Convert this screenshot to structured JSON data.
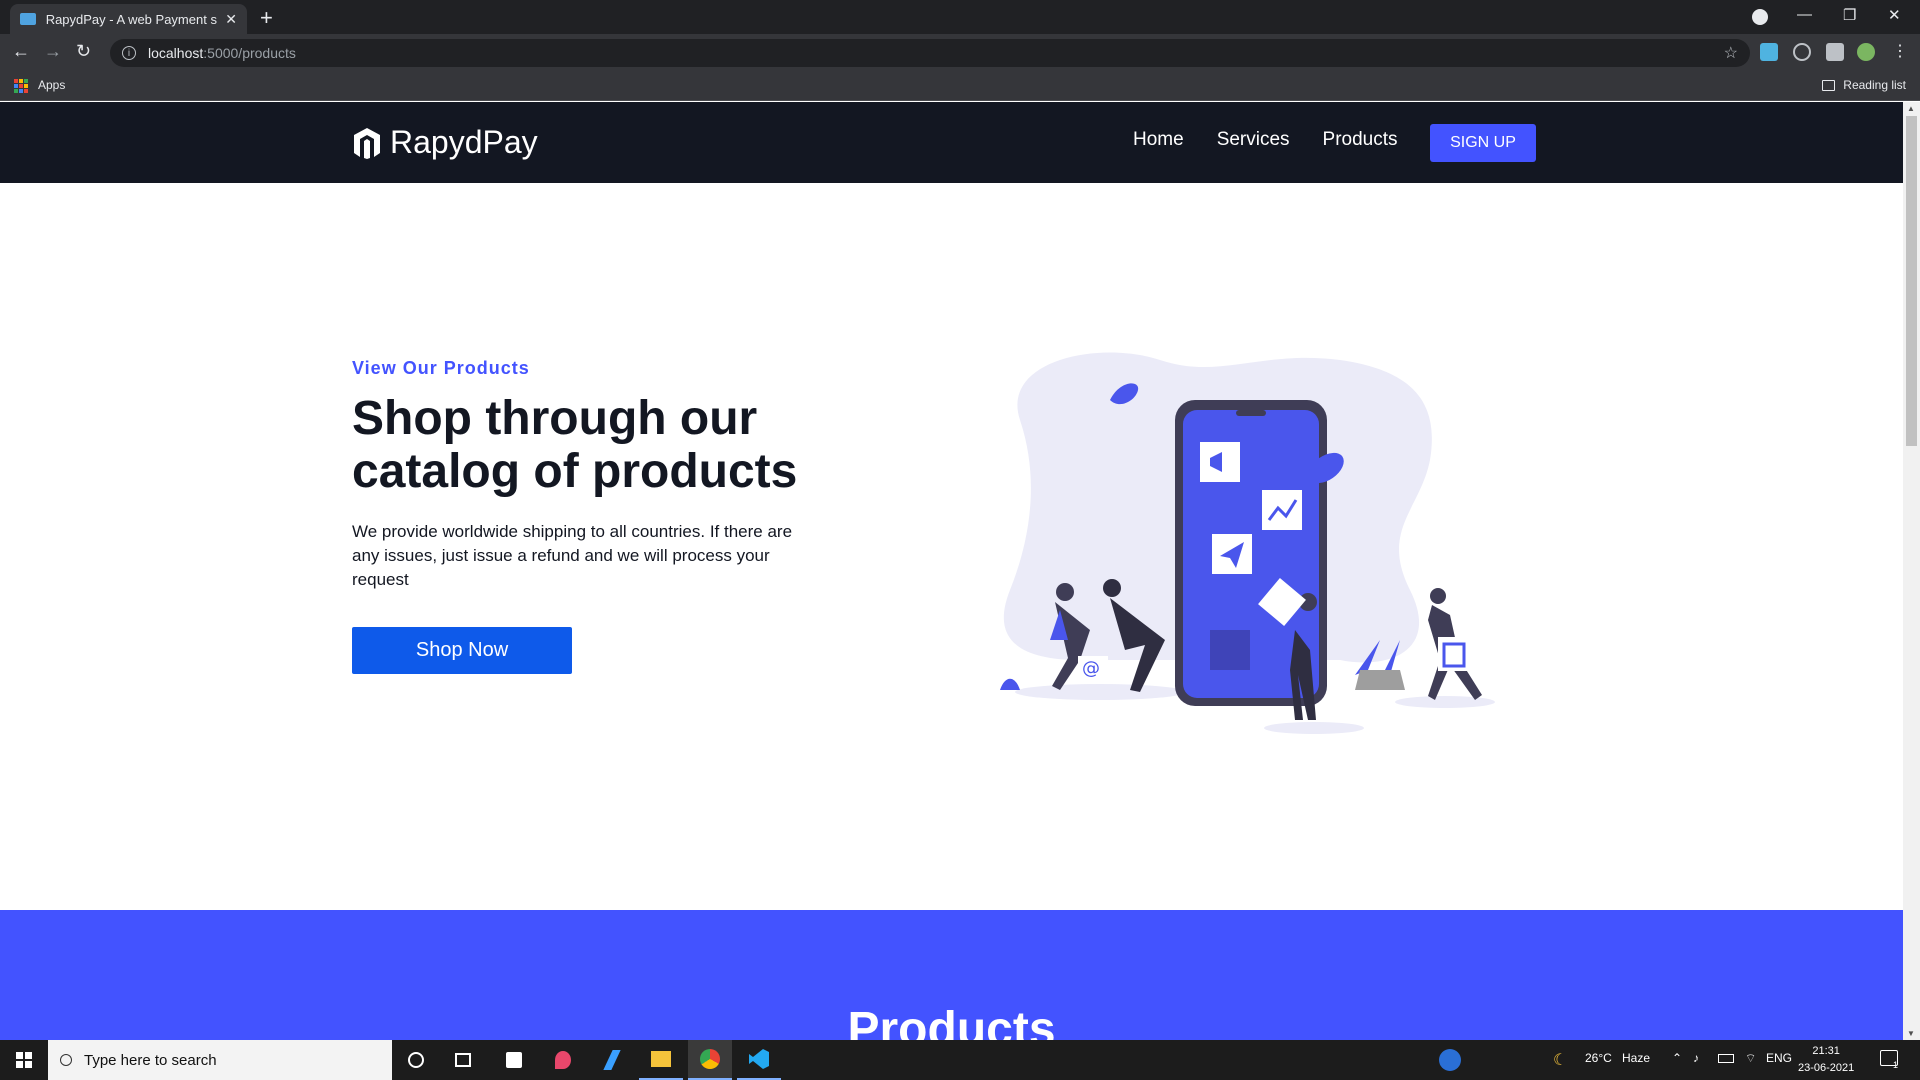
{
  "browser": {
    "tab_title": "RapydPay - A web Payment syste",
    "url_host": "localhost",
    "url_path": ":5000/products",
    "bookmark_apps": "Apps",
    "reading_list": "Reading list"
  },
  "navbar": {
    "brand": "RapydPay",
    "links": [
      "Home",
      "Services",
      "Products"
    ],
    "signup": "SIGN UP"
  },
  "hero": {
    "eyebrow": "View Our Products",
    "title": "Shop through our catalog of products",
    "description": "We provide worldwide shipping to all countries. If there are any issues, just issue a refund and we will process your request",
    "cta": "Shop Now"
  },
  "products_section": {
    "heading": "Products"
  },
  "taskbar": {
    "search_placeholder": "Type here to search",
    "weather_temp": "26°C",
    "weather_desc": "Haze",
    "language": "ENG",
    "time": "21:31",
    "date": "23-06-2021",
    "notification_count": "1"
  },
  "colors": {
    "accent": "#4353ff",
    "cta": "#0e5aea",
    "navbar_bg": "#131722",
    "illustration_blob": "#ebebf8"
  }
}
